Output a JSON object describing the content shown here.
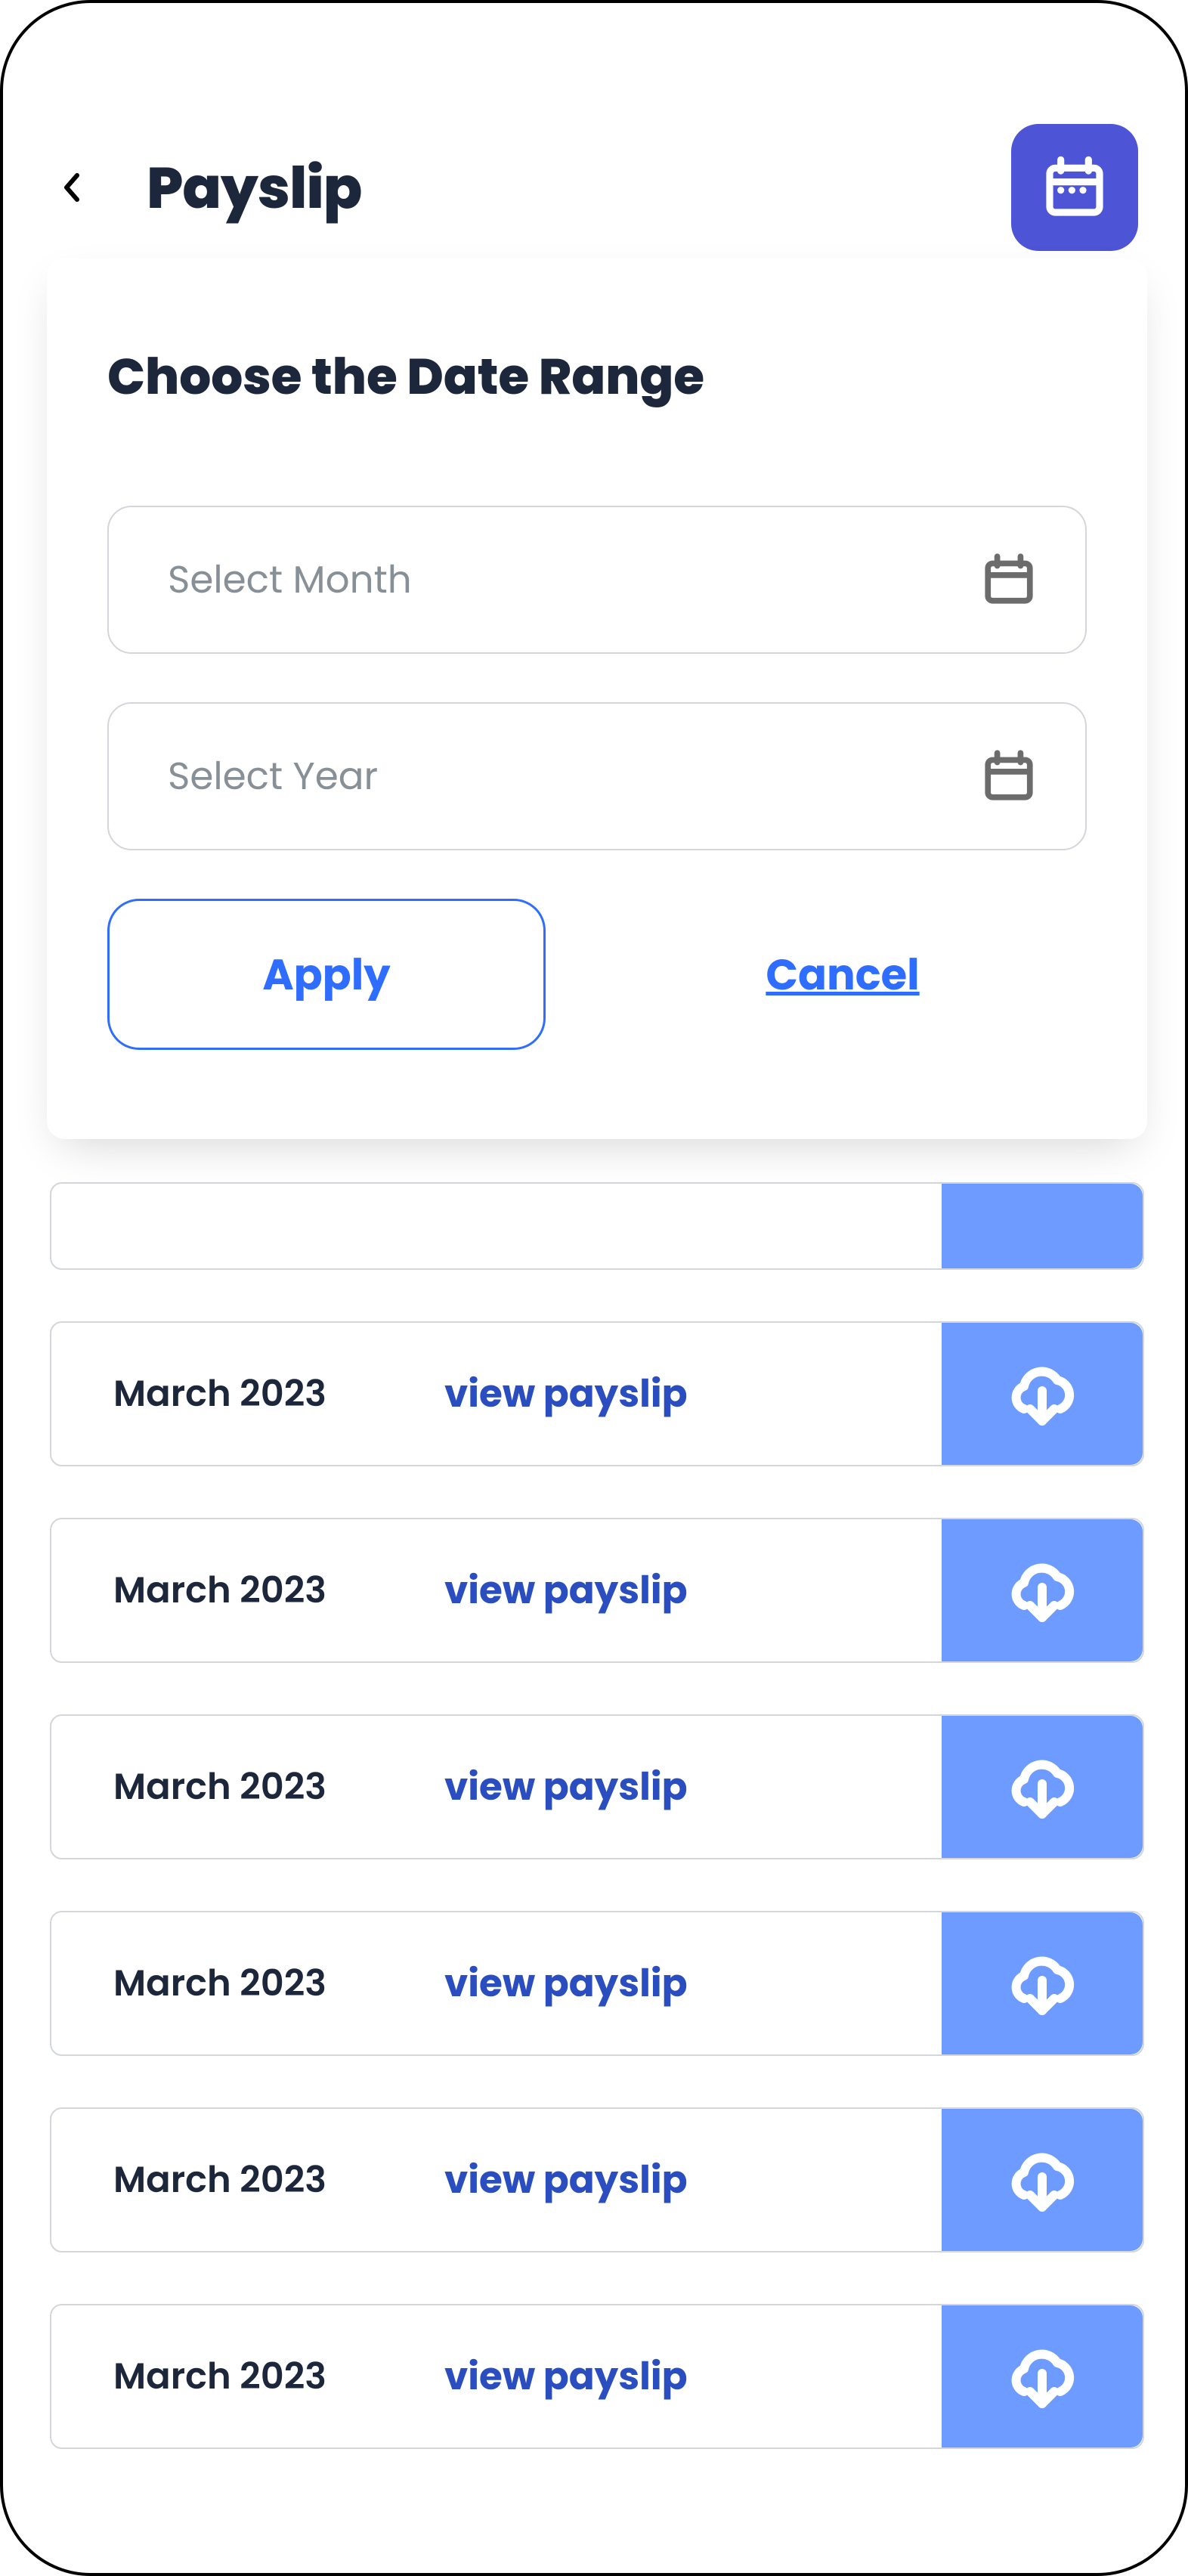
{
  "header": {
    "title": "Payslip"
  },
  "modal": {
    "heading": "Choose the Date Range",
    "month_placeholder": "Select Month",
    "year_placeholder": "Select Year",
    "apply_label": "Apply",
    "cancel_label": "Cancel"
  },
  "list": {
    "view_label": "view payslip",
    "items": [
      {
        "label": "March 2023"
      },
      {
        "label": "March 2023"
      },
      {
        "label": "March 2023"
      },
      {
        "label": "March 2023"
      },
      {
        "label": "March 2023"
      },
      {
        "label": "March 2023"
      }
    ]
  },
  "icons": {
    "back": "chevron-left-icon",
    "calendar": "calendar-icon",
    "download": "cloud-download-icon"
  },
  "colors": {
    "accent": "#2f6dff",
    "accent_light": "#6d9bff",
    "indigo": "#4e54d6"
  }
}
